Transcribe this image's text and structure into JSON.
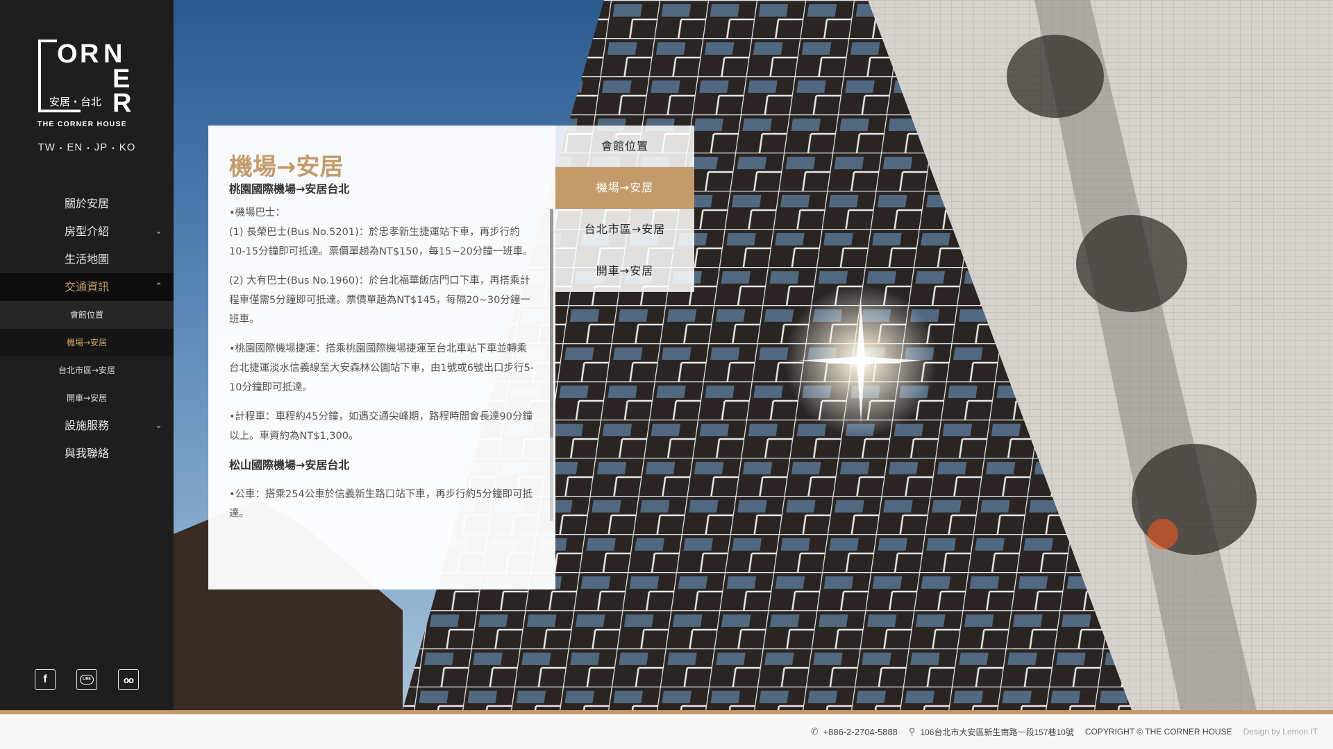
{
  "brand": {
    "logo_letters": [
      "C",
      "O",
      "R",
      "N",
      "E",
      "R"
    ],
    "logo_chinese": "安居・台北",
    "logo_english": "THE CORNER HOUSE"
  },
  "languages": [
    "TW",
    "EN",
    "JP",
    "KO"
  ],
  "nav": {
    "about": "關於安居",
    "rooms": "房型介紹",
    "life_map": "生活地圖",
    "transport": "交通資訊",
    "sub_location": "會館位置",
    "sub_airport": "機場→安居",
    "sub_city": "台北市區→安居",
    "sub_drive": "開車→安居",
    "facilities": "設施服務",
    "contact": "與我聯絡"
  },
  "social": {
    "facebook_label": "f",
    "line_label": "LINE",
    "tripadvisor_label": "oo"
  },
  "panel": {
    "title": "機場→安居",
    "subtitle": "桃園國際機場→安居台北",
    "p1_heading": "•機場巴士：",
    "p1": "(1) 長榮巴士(Bus No.5201)：於忠孝新生捷運站下車，再步行約10-15分鐘即可抵達。票價單趟為NT$150，每15~20分鐘一班車。",
    "p2": "(2) 大有巴士(Bus No.1960)：於台北福華飯店門口下車，再搭乘計程車僅需5分鐘即可抵達。票價單趟為NT$145，每隔20~30分鐘一班車。",
    "p3": "•桃園國際機場捷運：搭乘桃園國際機場捷運至台北車站下車並轉乘台北捷運淡水信義線至大安森林公園站下車，由1號或6號出口步行5-10分鐘即可抵達。",
    "p4": "•計程車：車程約45分鐘，如遇交通尖峰期，路程時間會長達90分鐘以上。車資約為NT$1,300。",
    "subtitle2": "松山國際機場→安居台北",
    "p5": "•公車：搭乘254公車於信義新生路口站下車，再步行約5分鐘即可抵達。"
  },
  "tabs": {
    "location": "會館位置",
    "airport": "機場→安居",
    "city": "台北市區→安居",
    "drive": "開車→安居"
  },
  "footer": {
    "phone": "+886-2-2704-5888",
    "address": "106台北市大安區新生南路一段157巷10號",
    "copyright": "COPYRIGHT © THE CORNER HOUSE",
    "credit": "Design by Lemon IT."
  },
  "colors": {
    "accent_gold": "#c39b6a",
    "sidebar_bg": "#1e1e1e"
  }
}
